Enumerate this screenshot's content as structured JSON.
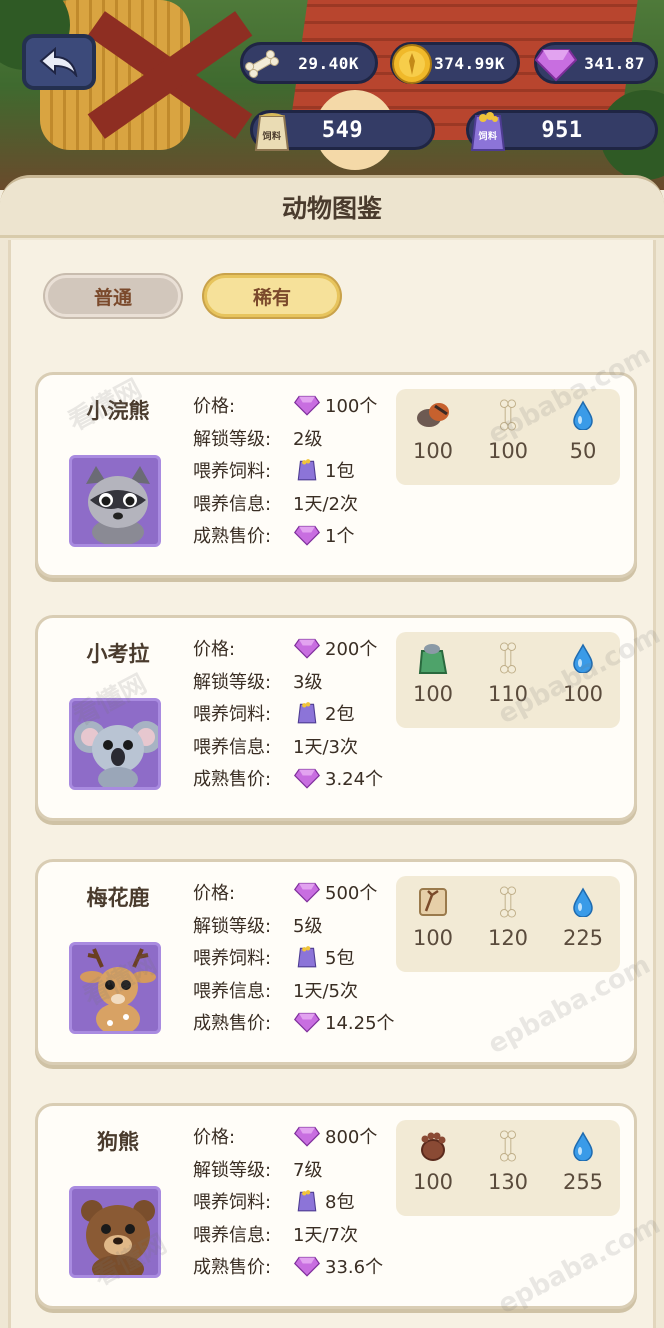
{
  "hud": {
    "bones": "29.40K",
    "coins": "374.99K",
    "gems": "341.87",
    "feed_normal": "549",
    "feed_rare": "951",
    "feed_label": "饲料"
  },
  "panel": {
    "title": "动物图鉴"
  },
  "tabs": [
    {
      "label": "普通",
      "active": false
    },
    {
      "label": "稀有",
      "active": true
    }
  ],
  "labels": {
    "price": "价格:",
    "unlock": "解锁等级:",
    "feed": "喂养饲料:",
    "feed_info": "喂养信息:",
    "sell": "成熟售价:"
  },
  "animals": [
    {
      "name": "小浣熊",
      "price": "100个",
      "unlock": "2级",
      "feed": "1包",
      "feed_info": "1天/2次",
      "sell": "1个",
      "req": {
        "item": "100",
        "bone": "100",
        "water": "50"
      },
      "item_icon": "raccoon-tail-icon"
    },
    {
      "name": "小考拉",
      "price": "200个",
      "unlock": "3级",
      "feed": "2包",
      "feed_info": "1天/3次",
      "sell": "3.24个",
      "req": {
        "item": "100",
        "bone": "110",
        "water": "100"
      },
      "item_icon": "leaf-bag-icon"
    },
    {
      "name": "梅花鹿",
      "price": "500个",
      "unlock": "5级",
      "feed": "5包",
      "feed_info": "1天/5次",
      "sell": "14.25个",
      "req": {
        "item": "100",
        "bone": "120",
        "water": "225"
      },
      "item_icon": "antler-scroll-icon"
    },
    {
      "name": "狗熊",
      "price": "800个",
      "unlock": "7级",
      "feed": "8包",
      "feed_info": "1天/7次",
      "sell": "33.6个",
      "req": {
        "item": "100",
        "bone": "130",
        "water": "255"
      },
      "item_icon": "bear-paw-icon"
    }
  ],
  "watermarks": [
    "看懂网",
    "epbaba.com"
  ],
  "colors": {
    "gem": "#b45ad6",
    "pill_bg": "#343c66",
    "pic_bg": "#8e6cc8",
    "water": "#3a9be8"
  }
}
